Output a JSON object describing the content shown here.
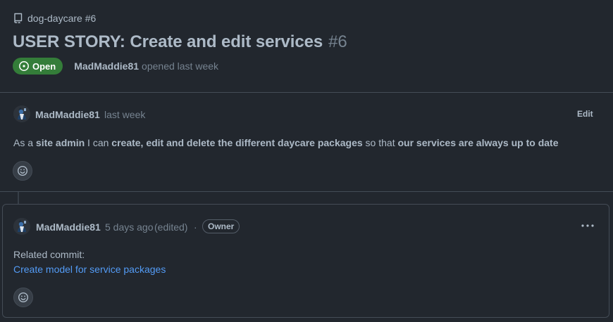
{
  "repo": {
    "breadcrumb": "dog-daycare #6",
    "icon": "repo-icon"
  },
  "issue": {
    "title": "USER STORY: Create and edit services",
    "number": "#6",
    "state": "Open",
    "state_color": "#347d39",
    "author": "MadMaddie81",
    "action": "opened last week"
  },
  "body_comment": {
    "author": "MadMaddie81",
    "time": "last week",
    "edit_label": "Edit",
    "text": {
      "t1": "As a ",
      "b1": "site admin",
      "t2": " I can ",
      "b2": "create, edit and delete the different daycare packages",
      "t3": " so that ",
      "b3": "our services are always up to date"
    },
    "reaction_icon": "smiley-icon"
  },
  "comment": {
    "author": "MadMaddie81",
    "time": "5 days ago",
    "edited": "(edited)",
    "separator": "·",
    "role_badge": "Owner",
    "menu_icon": "kebab-horizontal-icon",
    "related_label": "Related commit:",
    "link_text": "Create model for service packages",
    "link_color": "#539bf5",
    "reaction_icon": "smiley-icon"
  }
}
